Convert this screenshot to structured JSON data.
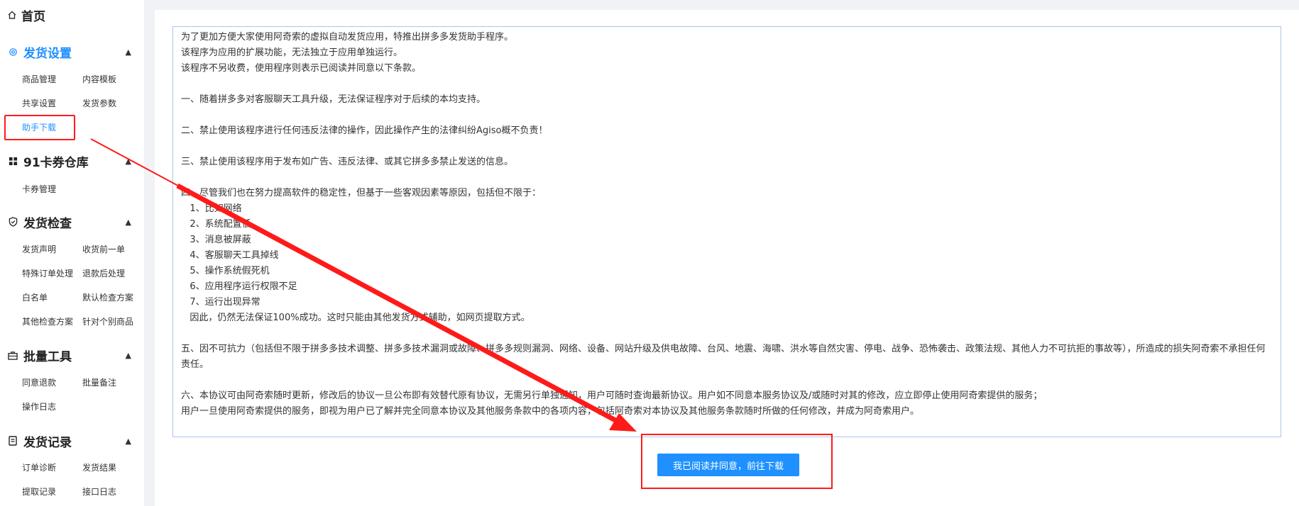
{
  "sidebar": {
    "home": "首页",
    "sections": [
      {
        "title": "发货设置",
        "icon": "gear-icon",
        "items": [
          "商品管理",
          "内容模板",
          "共享设置",
          "发货参数",
          "助手下载"
        ]
      },
      {
        "title": "91卡券仓库",
        "icon": "grid-icon",
        "items": [
          "卡券管理"
        ]
      },
      {
        "title": "发货检查",
        "icon": "shield-icon",
        "items": [
          "发货声明",
          "收货前一单",
          "特殊订单处理",
          "退款后处理",
          "白名单",
          "默认检查方案",
          "其他检查方案",
          "针对个别商品"
        ]
      },
      {
        "title": "批量工具",
        "icon": "briefcase-icon",
        "items": [
          "同意退款",
          "批量备注",
          "操作日志"
        ]
      },
      {
        "title": "发货记录",
        "icon": "document-icon",
        "items": [
          "订单诊断",
          "发货结果",
          "提取记录",
          "接口日志"
        ]
      }
    ]
  },
  "agreement": {
    "text": "为了更加方便大家使用阿奇索的虚拟自动发货应用，特推出拼多多发货助手程序。\n该程序为应用的扩展功能，无法独立于应用单独运行。\n该程序不另收费，使用程序则表示已阅读并同意以下条款。\n\n一、随着拼多多对客服聊天工具升级，无法保证程序对于后续的本均支持。\n\n二、禁止使用该程序进行任何违反法律的操作，因此操作产生的法律纠纷Agiso概不负责！\n\n三、禁止使用该程序用于发布如广告、违反法律、或其它拼多多禁止发送的信息。\n\n四、尽管我们也在努力提高软件的稳定性，但基于一些客观因素等原因，包括但不限于：\n   1、比如网络\n   2、系统配置低\n   3、消息被屏蔽\n   4、客服聊天工具掉线\n   5、操作系统假死机\n   6、应用程序运行权限不足\n   7、运行出现异常\n   因此，仍然无法保证100%成功。这时只能由其他发货方式辅助，如网页提取方式。\n\n五、因不可抗力（包括但不限于拼多多技术调整、拼多多技术漏洞或故障、拼多多规则漏洞、网络、设备、网站升级及供电故障、台风、地震、海啸、洪水等自然灾害、停电、战争、恐怖袭击、政策法规、其他人力不可抗拒的事故等），所造成的损失阿奇索不承担任何责任。\n\n六、本协议可由阿奇索随时更新，修改后的协议一旦公布即有效替代原有协议，无需另行单独通知，用户可随时查询最新协议。用户如不同意本服务协议及/或随时对其的修改，应立即停止使用阿奇索提供的服务；\n用户一旦使用阿奇索提供的服务，即视为用户已了解并完全同意本协议及其他服务条款中的各项内容，包括阿奇索对本协议及其他服务条款随时所做的任何修改，并成为阿奇索用户。"
  },
  "agree_button": "我已阅读并同意，前往下载",
  "colors": {
    "accent": "#1e90ff",
    "annotation": "#ff1a1a"
  }
}
